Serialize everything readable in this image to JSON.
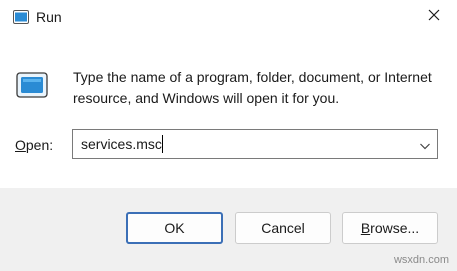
{
  "window": {
    "title": "Run",
    "icon": "run-icon",
    "close_icon": "close-icon"
  },
  "dialog": {
    "description": "Type the name of a program, folder, document, or Internet resource, and Windows will open it for you.",
    "open_label_accel": "O",
    "open_label_rest": "pen:",
    "open_value": "services.msc"
  },
  "buttons": {
    "ok": "OK",
    "cancel": "Cancel",
    "browse_accel": "B",
    "browse_rest": "rowse..."
  },
  "watermark": "wsxdn.com",
  "colors": {
    "accent": "#3b6fb6",
    "icon_blue": "#2a8bd4"
  }
}
